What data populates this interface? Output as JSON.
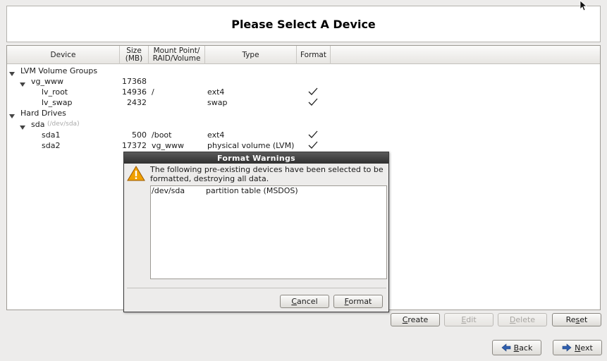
{
  "header": {
    "title": "Please Select A Device"
  },
  "table": {
    "columns": [
      {
        "label": "Device"
      },
      {
        "label": "Size\n(MB)"
      },
      {
        "label": "Mount Point/\nRAID/Volume"
      },
      {
        "label": "Type"
      },
      {
        "label": "Format"
      }
    ],
    "rows": [
      {
        "device": "LVM Volume Groups",
        "level": 0,
        "expander": true
      },
      {
        "device": "vg_www",
        "level": 1,
        "expander": true,
        "size": "17368"
      },
      {
        "device": "lv_root",
        "level": 2,
        "size": "14936",
        "mount": "/",
        "type": "ext4",
        "format": true
      },
      {
        "device": "lv_swap",
        "level": 2,
        "size": "2432",
        "type": "swap",
        "format": true
      },
      {
        "device": "Hard Drives",
        "level": 0,
        "expander": true
      },
      {
        "device": "sda",
        "hint": "(/dev/sda)",
        "level": 1,
        "expander": true
      },
      {
        "device": "sda1",
        "level": 2,
        "size": "500",
        "mount": "/boot",
        "type": "ext4",
        "format": true
      },
      {
        "device": "sda2",
        "level": 2,
        "size": "17372",
        "mount": "vg_www",
        "type": "physical volume (LVM)",
        "format": true
      }
    ]
  },
  "actions": {
    "create": {
      "label": "Create",
      "mnemonic": "C",
      "rest": "reate"
    },
    "edit": {
      "label": "Edit",
      "mnemonic": "E",
      "rest": "dit"
    },
    "delete": {
      "label": "Delete",
      "mnemonic": "D",
      "rest": "elete"
    },
    "reset": {
      "label": "Reset",
      "mnemonic": "s",
      "pre": "Re",
      "post": "et"
    }
  },
  "nav": {
    "back": {
      "label": "Back",
      "mnemonic": "B",
      "rest": "ack"
    },
    "next": {
      "label": "Next",
      "mnemonic": "N",
      "rest": "ext"
    }
  },
  "dialog": {
    "title": "Format Warnings",
    "message": "The following pre-existing devices have been selected to be formatted, destroying all data.",
    "list": [
      {
        "device": "/dev/sda",
        "description": "partition table (MSDOS)"
      }
    ],
    "cancel": {
      "label": "Cancel",
      "mnemonic": "C",
      "rest": "ancel"
    },
    "format": {
      "label": "Format",
      "mnemonic": "F",
      "rest": "ormat"
    }
  },
  "colors": {
    "warning": "#f0a000",
    "title_bar": "#303030",
    "check": "#222222"
  }
}
